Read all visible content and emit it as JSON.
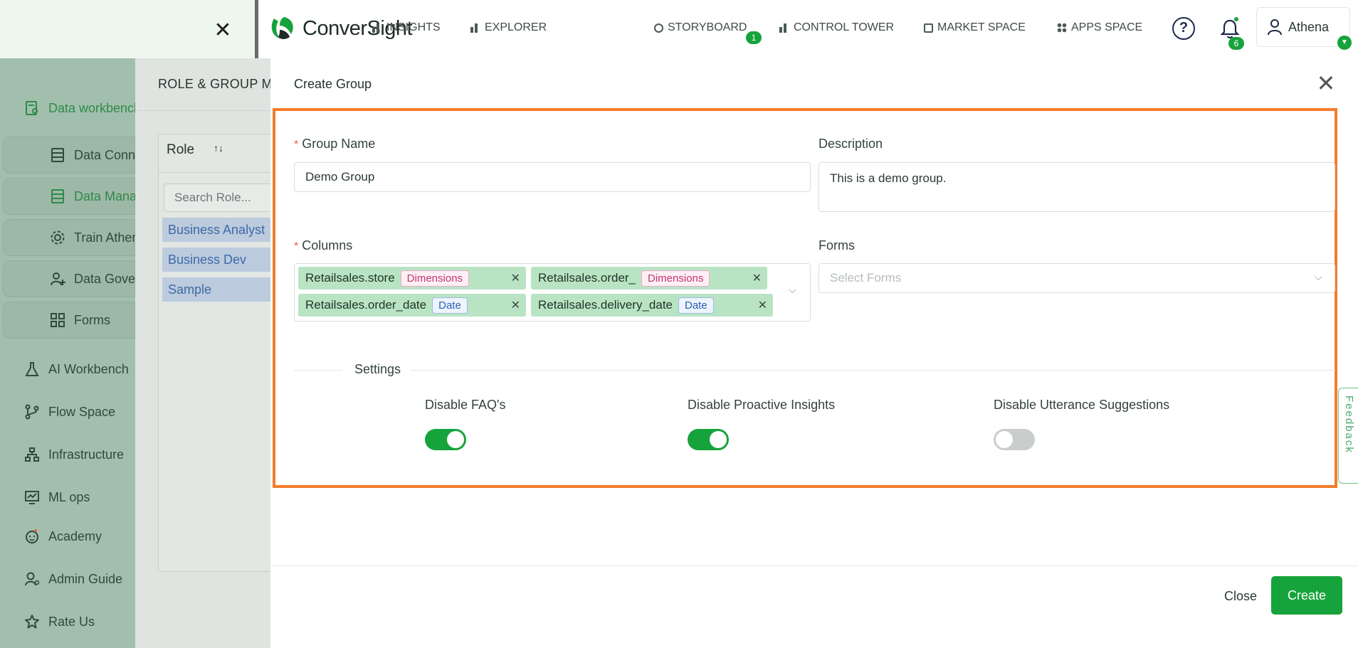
{
  "topleft": {
    "close_icon": "close-icon"
  },
  "navbar": {
    "logo_text": "ConverSight",
    "items": [
      {
        "label": "INSIGHTS",
        "icon": "bars-icon"
      },
      {
        "label": "EXPLORER",
        "icon": "bars-icon"
      },
      {
        "label": "STORYBOARD",
        "icon": "storyboard-icon",
        "badge": "1"
      },
      {
        "label": "CONTROL TOWER",
        "icon": "control-tower-icon"
      },
      {
        "label": "MARKET SPACE",
        "icon": "market-space-icon"
      },
      {
        "label": "APPS SPACE",
        "icon": "apps-space-icon"
      }
    ],
    "help_icon": "?",
    "notification_count": "6",
    "user_name": "Athena"
  },
  "sidebar": {
    "items": [
      {
        "label": "Data workbench"
      },
      {
        "label": "Data Connections"
      },
      {
        "label": "Data Management"
      },
      {
        "label": "Train Athena"
      },
      {
        "label": "Data Governance"
      },
      {
        "label": "Forms"
      },
      {
        "label": "AI Workbench"
      },
      {
        "label": "Flow Space"
      },
      {
        "label": "Infrastructure"
      },
      {
        "label": "ML ops"
      },
      {
        "label": "Academy"
      },
      {
        "label": "Admin Guide"
      },
      {
        "label": "Rate Us"
      }
    ]
  },
  "role_panel": {
    "title": "ROLE & GROUP MANAGEMENT",
    "column_header": "Role",
    "search_placeholder": "Search Role...",
    "roles": [
      "Business Analyst",
      "Business Dev",
      "Sample"
    ]
  },
  "modal": {
    "title": "Create Group",
    "group_name_label": "Group Name",
    "group_name_value": "Demo Group",
    "description_label": "Description",
    "description_value": "This is a demo group.",
    "columns_label": "Columns",
    "columns": [
      {
        "name": "Retailsales.store",
        "type": "Dimensions"
      },
      {
        "name": "Retailsales.order_",
        "type": "Dimensions"
      },
      {
        "name": "Retailsales.order_date",
        "type": "Date"
      },
      {
        "name": "Retailsales.delivery_date",
        "type": "Date"
      }
    ],
    "forms_label": "Forms",
    "forms_placeholder": "Select Forms",
    "settings_label": "Settings",
    "settings": [
      {
        "label": "Disable FAQ's",
        "enabled": true
      },
      {
        "label": "Disable Proactive Insights",
        "enabled": true
      },
      {
        "label": "Disable Utterance Suggestions",
        "enabled": false
      }
    ],
    "close_label": "Close",
    "create_label": "Create"
  },
  "feedback_label": "Feedback",
  "colors": {
    "accent": "#17a33c",
    "highlight": "#f47c2c"
  }
}
